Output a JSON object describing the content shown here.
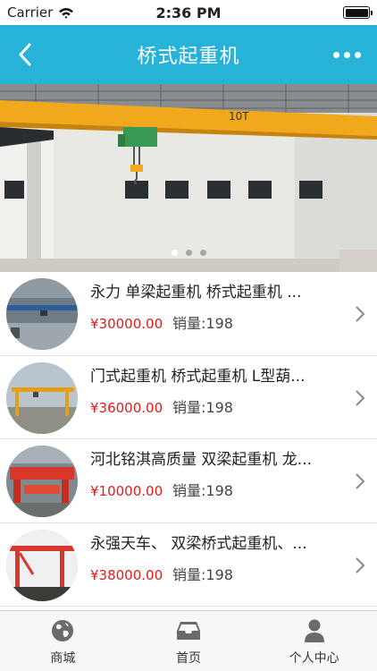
{
  "status_bar": {
    "carrier": "Carrier",
    "time": "2:36 PM"
  },
  "nav": {
    "title": "桥式起重机",
    "back_icon": "chevron-left-icon",
    "more_icon": "more-dots-icon"
  },
  "banner": {
    "crane_label": "10T",
    "slide_count": 3,
    "active_slide": 1
  },
  "products": [
    {
      "name": "永力 单梁起重机 桥式起重机 ...",
      "price": "¥30000.00",
      "sales": "销量:198"
    },
    {
      "name": "门式起重机 桥式起重机 L型葫...",
      "price": "¥36000.00",
      "sales": "销量:198"
    },
    {
      "name": "河北铭淇高质量 双梁起重机 龙...",
      "price": "¥10000.00",
      "sales": "销量:198"
    },
    {
      "name": "永强天车、 双梁桥式起重机、...",
      "price": "¥38000.00",
      "sales": "销量:198"
    }
  ],
  "tabs": [
    {
      "label": "商城",
      "icon": "globe-icon"
    },
    {
      "label": "首页",
      "icon": "inbox-icon"
    },
    {
      "label": "个人中心",
      "icon": "person-icon"
    }
  ],
  "colors": {
    "accent": "#27b3d8",
    "price": "#e21b1b",
    "crane": "#f2a81d"
  }
}
